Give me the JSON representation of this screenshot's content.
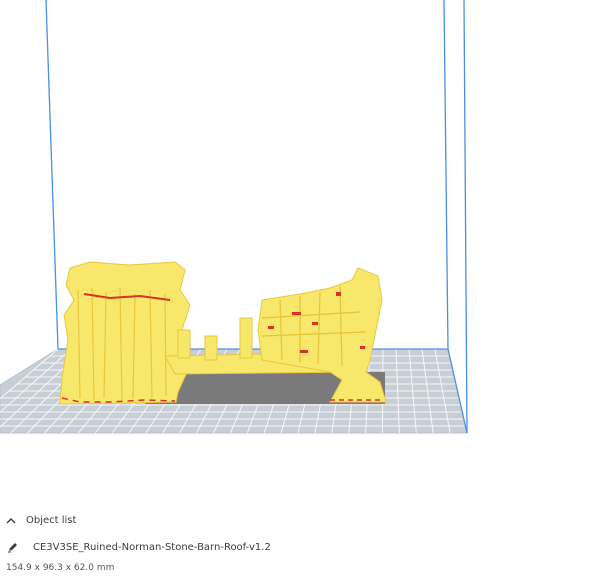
{
  "object_list": {
    "header_label": "Object list",
    "file_name": "CE3V3SE_Ruined-Norman-Stone-Barn-Roof-v1.2",
    "dimensions": "154.9 x 96.3 x 62.0 mm"
  },
  "icons": {
    "collapse": "chevron-up-icon",
    "edit": "pencil-icon"
  },
  "colors": {
    "build_volume_edge": "#4a90e2",
    "build_plate": "#c8ced6",
    "plate_grid": "#ffffff",
    "model": "#f7e76a",
    "model_dark": "#e8c840",
    "overhang": "#d8322a",
    "shadow": "#7a7a7a"
  }
}
